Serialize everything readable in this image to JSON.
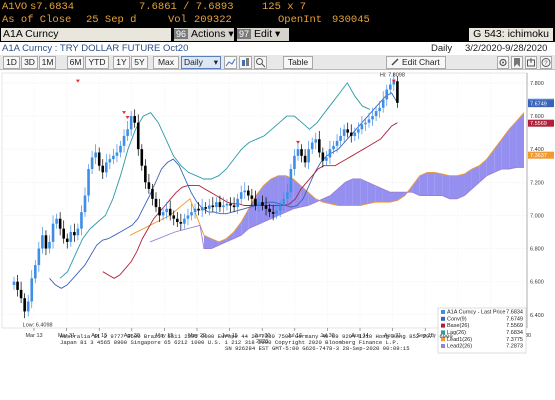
{
  "quote": {
    "ticker": "A1VO",
    "last": "s7.6834",
    "range": "7.6861 / 7.6893",
    "size": "125 x 7",
    "asof_label": "As of Close",
    "asof_date": "25 Sep d",
    "vol_label": "Vol",
    "vol_value": "209322",
    "oi_label": "OpenInt",
    "oi_value": "930045"
  },
  "command": {
    "security": "A1A Curncy",
    "actions_num": "96",
    "actions_label": "Actions",
    "edit_num": "97",
    "edit_label": "Edit",
    "function_title": "G 543: ichimoku"
  },
  "titlebar": {
    "title": "A1A Curncy : TRY DOLLAR FUTURE Oct20",
    "period": "Daily",
    "range": "3/2/2020-9/28/2020"
  },
  "toolbar": {
    "periods": [
      "1D",
      "3D",
      "1M",
      "6M",
      "YTD",
      "1Y",
      "5Y",
      "Max"
    ],
    "frequency": "Daily",
    "table_label": "Table",
    "edit_chart_label": "Edit Chart"
  },
  "footer": {
    "line1": "Australia 61 2 9777 8600  Brazil 5511 2395 9000  Europe 44 20 7330 7500  Germany 49 69 9204 1210  Hong Kong 852 2977 6000",
    "line2": "Japan 81 3 4565 8900        Singapore 65 6212 1000        U.S. 1 212 318 2000        Copyright 2020 Bloomberg Finance L.P.",
    "line3": "SN 926284 EST  GMT-5:00 G626-7478-3 28-Sep-2020 00:09:15"
  },
  "colors": {
    "price_up": "#3e8ee8",
    "price_down": "#000000",
    "conversion": "#3a62b8",
    "base": "#b0203a",
    "lagging": "#2a9aa8",
    "lead1": "#f09a30",
    "lead2": "#9b7fd4",
    "cloud": "#8a84ee"
  },
  "chart_data": {
    "type": "candlestick-ichimoku",
    "x_ticks": [
      "Mar 13",
      "Mar 31",
      "Apr 15",
      "Apr 30",
      "May 15",
      "May 29",
      "Jun 15",
      "Jun 30",
      "Jul 16",
      "Jul 30",
      "Aug 14",
      "Aug 31",
      "Sep 15",
      "Sep 30",
      "Oct 15",
      "Oct 30"
    ],
    "x_year_label": "2020",
    "y_ticks": [
      6.4,
      6.6,
      6.8,
      7.0,
      7.2,
      7.4,
      7.6,
      7.8
    ],
    "ylim": [
      6.32,
      7.86
    ],
    "high_label": "Hi: 7.8098",
    "low_label": "Low: 6.4098",
    "price_tags": [
      {
        "value": 7.6834,
        "label": "7.6834",
        "color": "#3e8ee8"
      },
      {
        "value": 7.6749,
        "label": "7.6749",
        "color": "#3a62b8"
      },
      {
        "value": 7.5569,
        "label": "7.5569",
        "color": "#b0203a"
      },
      {
        "value": 7.3637,
        "label": "7.3637",
        "color": "#f09a30"
      }
    ],
    "legend": [
      {
        "name": "A1A Curncy - Last Price",
        "value": "7.6834",
        "color": "#3e8ee8"
      },
      {
        "name": "Conv(9)",
        "value": "7.6749",
        "color": "#3a62b8"
      },
      {
        "name": "Base(26)",
        "value": "7.5569",
        "color": "#b0203a"
      },
      {
        "name": "Lag(26)",
        "value": "7.6834",
        "color": "#2a9aa8"
      },
      {
        "name": "Lead1(26)",
        "value": "7.3775",
        "color": "#f09a30"
      },
      {
        "name": "Lead2(26)",
        "value": "7.2873",
        "color": "#9b7fd4"
      }
    ],
    "closes": [
      6.6,
      6.55,
      6.5,
      6.42,
      6.48,
      6.62,
      6.7,
      6.8,
      6.88,
      6.8,
      6.84,
      6.95,
      6.98,
      6.92,
      6.86,
      6.84,
      6.9,
      6.88,
      6.92,
      7.02,
      7.12,
      7.28,
      7.35,
      7.38,
      7.3,
      7.26,
      7.32,
      7.34,
      7.36,
      7.38,
      7.42,
      7.48,
      7.52,
      7.6,
      7.56,
      7.4,
      7.3,
      7.2,
      7.16,
      7.1,
      7.05,
      7.0,
      7.02,
      7.04,
      7.0,
      6.98,
      6.96,
      6.95,
      6.98,
      7.0,
      7.02,
      7.04,
      7.03,
      7.05,
      7.04,
      7.06,
      7.05,
      7.08,
      7.05,
      7.06,
      7.07,
      7.06,
      7.05,
      7.1,
      7.14,
      7.15,
      7.12,
      7.1,
      7.06,
      7.08,
      7.06,
      7.04,
      7.02,
      7.01,
      7.03,
      7.06,
      7.1,
      7.14,
      7.28,
      7.36,
      7.4,
      7.36,
      7.32,
      7.4,
      7.44,
      7.46,
      7.38,
      7.33,
      7.35,
      7.4,
      7.42,
      7.45,
      7.48,
      7.52,
      7.5,
      7.48,
      7.5,
      7.52,
      7.55,
      7.56,
      7.58,
      7.6,
      7.63,
      7.65,
      7.7,
      7.76,
      7.79,
      7.81,
      7.68
    ],
    "conversion": [
      6.62,
      6.58,
      6.56,
      6.58,
      6.62,
      6.66,
      6.7,
      6.76,
      6.82,
      6.85,
      6.86,
      6.88,
      6.9,
      6.92,
      6.94,
      6.98,
      7.05,
      7.12,
      7.2,
      7.28,
      7.32,
      7.34,
      7.3,
      7.22,
      7.14,
      7.08,
      7.04,
      7.02,
      7.02,
      7.01,
      7.01,
      7.02,
      7.03,
      7.04,
      7.05,
      7.06,
      7.07,
      7.08,
      7.08,
      7.07,
      7.06,
      7.05,
      7.06,
      7.1,
      7.18,
      7.26,
      7.32,
      7.36,
      7.38,
      7.4,
      7.44,
      7.48,
      7.52,
      7.56,
      7.6,
      7.64,
      7.68,
      7.72,
      7.74,
      7.68
    ],
    "base": [
      6.66,
      6.64,
      6.62,
      6.64,
      6.68,
      6.72,
      6.78,
      6.86,
      6.92,
      6.98,
      7.02,
      7.06,
      7.1,
      7.14,
      7.17,
      7.18,
      7.18,
      7.18,
      7.16,
      7.14,
      7.12,
      7.1,
      7.08,
      7.07,
      7.07,
      7.06,
      7.06,
      7.06,
      7.06,
      7.06,
      7.06,
      7.06,
      7.06,
      7.07,
      7.1,
      7.16,
      7.2,
      7.24,
      7.28,
      7.3,
      7.3,
      7.3,
      7.32,
      7.34,
      7.36,
      7.38,
      7.4,
      7.42,
      7.44,
      7.46,
      7.5,
      7.54,
      7.56
    ],
    "lagging": [
      6.62,
      6.66,
      6.76,
      6.86,
      6.92,
      6.96,
      7.0,
      7.1,
      7.24,
      7.4,
      7.52,
      7.6,
      7.62,
      7.56,
      7.46,
      7.36,
      7.3,
      7.26,
      7.24,
      7.22,
      7.22,
      7.24,
      7.28,
      7.34,
      7.4,
      7.44,
      7.46,
      7.48,
      7.52,
      7.56,
      7.6,
      7.6,
      7.56,
      7.52,
      7.56,
      7.62,
      7.68,
      7.74,
      7.8,
      7.72,
      7.66,
      7.64
    ],
    "lead1": [
      6.88,
      6.86,
      6.84,
      6.86,
      6.9,
      6.96,
      7.04,
      7.12,
      7.18,
      7.22,
      7.24,
      7.24,
      7.22,
      7.18,
      7.14,
      7.1,
      7.08,
      7.07,
      7.06,
      7.06,
      7.06,
      7.06,
      7.07,
      7.08,
      7.08,
      7.08,
      7.09,
      7.12,
      7.18,
      7.24,
      7.26,
      7.26,
      7.25,
      7.24,
      7.24,
      7.25,
      7.28,
      7.3,
      7.34,
      7.4,
      7.46,
      7.52,
      7.57,
      7.62
    ],
    "lead2": [
      6.8,
      6.8,
      6.82,
      6.84,
      6.86,
      6.88,
      6.92,
      6.94,
      6.96,
      6.98,
      7.0,
      7.02,
      7.04,
      7.05,
      7.06,
      7.08,
      7.1,
      7.12,
      7.16,
      7.2,
      7.22,
      7.22,
      7.2,
      7.18,
      7.16,
      7.14,
      7.14,
      7.14,
      7.14,
      7.12,
      7.12,
      7.12,
      7.12,
      7.1,
      7.1,
      7.12,
      7.16,
      7.2,
      7.24,
      7.26,
      7.28,
      7.28,
      7.29,
      7.29
    ]
  }
}
